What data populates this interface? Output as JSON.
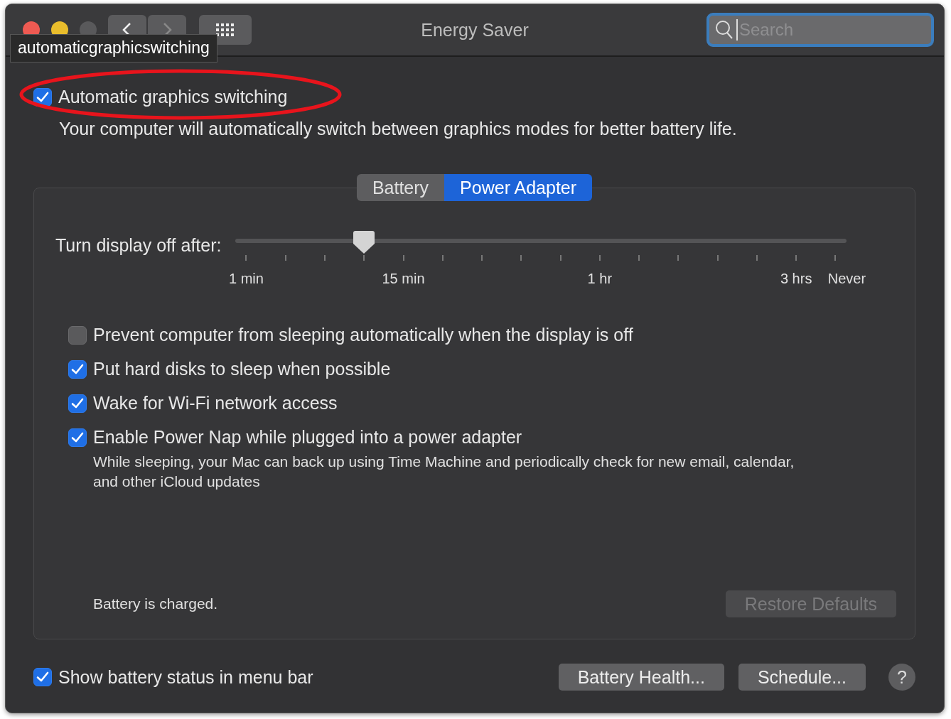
{
  "window": {
    "title": "Energy Saver"
  },
  "search": {
    "placeholder": "Search"
  },
  "tooltip": "automaticgraphicswitching",
  "graphics_switching": {
    "label": "Automatic graphics switching",
    "checked": true,
    "description": "Your computer will automatically switch between graphics modes for better battery life."
  },
  "tabs": [
    {
      "label": "Battery",
      "selected": false
    },
    {
      "label": "Power Adapter",
      "selected": true
    }
  ],
  "display_slider": {
    "label": "Turn display off after:",
    "level": 0.2,
    "ticks": [
      "1 min",
      "15 min",
      "1 hr",
      "3 hrs",
      "Never"
    ]
  },
  "options": [
    {
      "label": "Prevent computer from sleeping automatically when the display is off",
      "checked": false
    },
    {
      "label": "Put hard disks to sleep when possible",
      "checked": true
    },
    {
      "label": "Wake for Wi-Fi network access",
      "checked": true
    },
    {
      "label": "Enable Power Nap while plugged into a power adapter",
      "checked": true,
      "description": "While sleeping, your Mac can back up using Time Machine and periodically check for new email, calendar, and other iCloud updates"
    }
  ],
  "status": "Battery is charged.",
  "restore_button": {
    "label": "Restore Defaults",
    "disabled": true
  },
  "show_battery_status": {
    "label": "Show battery status in menu bar",
    "checked": true
  },
  "buttons": [
    "Battery Health...",
    "Schedule..."
  ],
  "help": "?"
}
